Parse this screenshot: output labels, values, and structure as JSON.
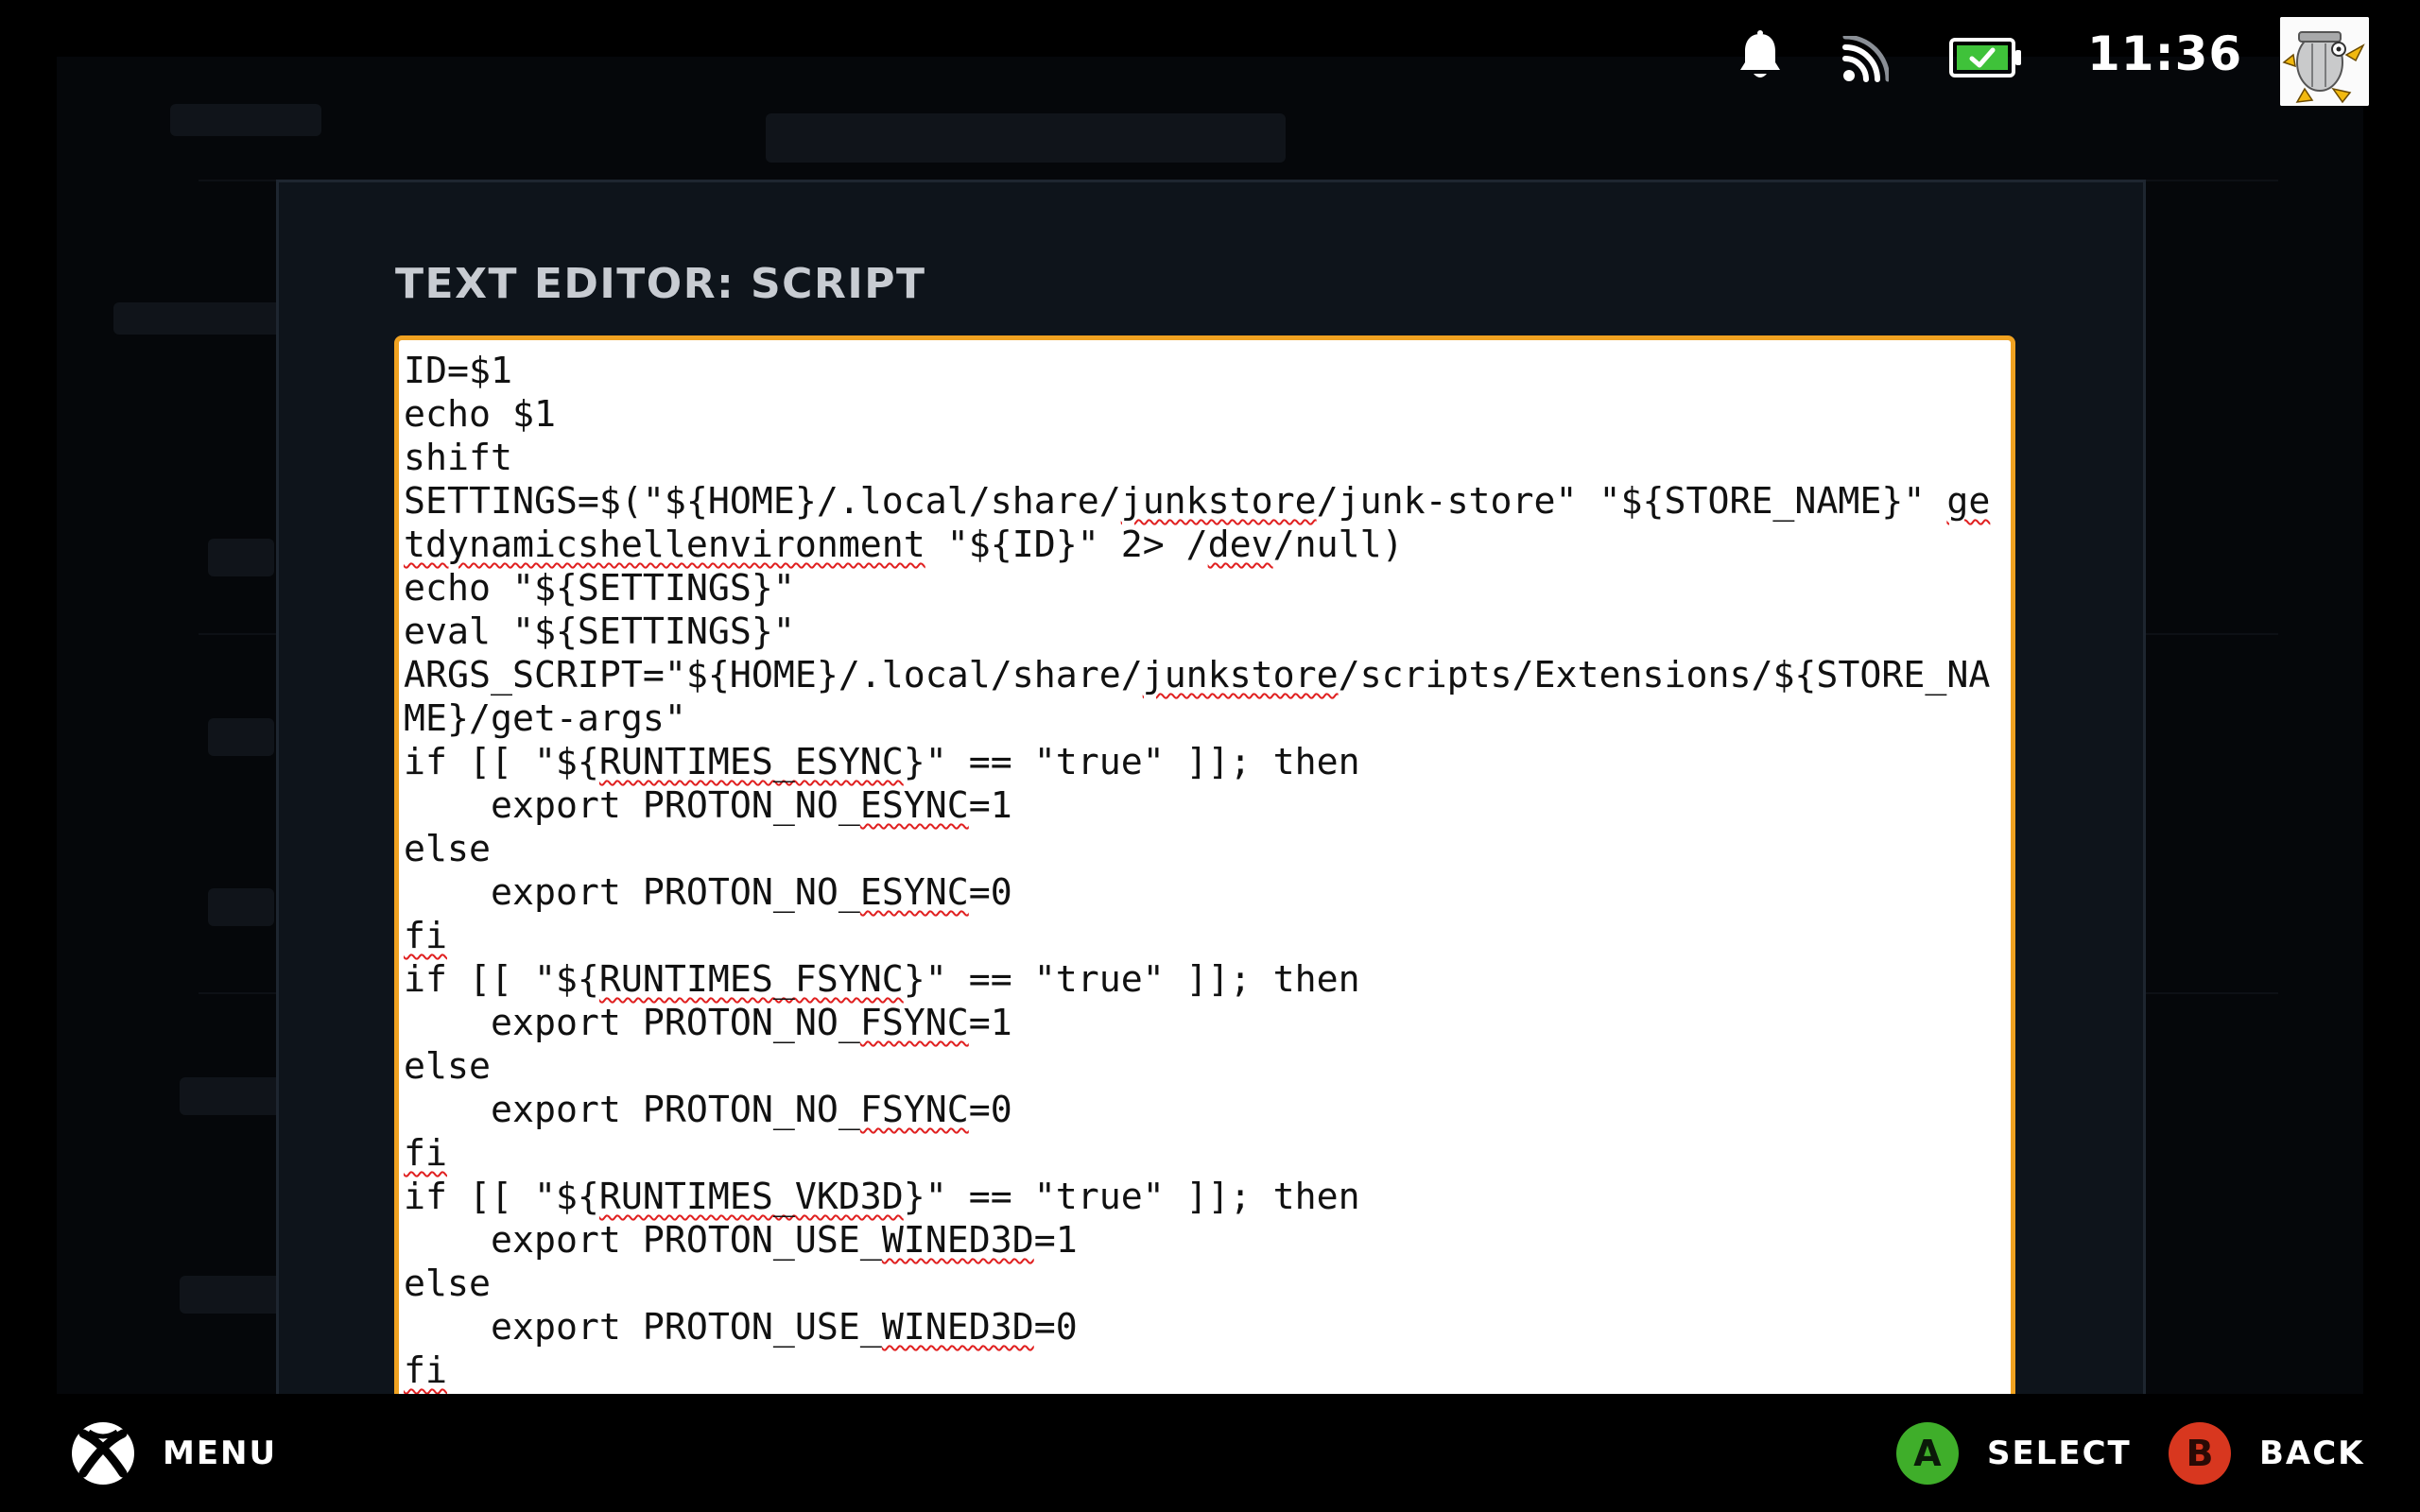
{
  "status_bar": {
    "time": "11:36",
    "icons": [
      "notification-bell-icon",
      "wifi-icon",
      "battery-charging-icon"
    ],
    "avatar": "user-avatar"
  },
  "modal": {
    "title": "TEXT EDITOR: SCRIPT",
    "accent_color": "#f0a221",
    "lines": [
      [
        {
          "t": "ID=$1"
        }
      ],
      [
        {
          "t": "echo $1"
        }
      ],
      [
        {
          "t": "shift"
        }
      ],
      [
        {
          "t": "SETTINGS=$(\"${HOME}/.local/share/"
        },
        {
          "t": "junkstore",
          "sq": true
        },
        {
          "t": "/junk-store\" \"${STORE_NAME}\" "
        },
        {
          "t": "getdynamicshellenvironment",
          "sq": true
        },
        {
          "t": " \"${ID}\" 2> /"
        },
        {
          "t": "dev",
          "sq": true
        },
        {
          "t": "/null)"
        }
      ],
      [
        {
          "t": "echo \"${SETTINGS}\""
        }
      ],
      [
        {
          "t": "eval \"${SETTINGS}\""
        }
      ],
      [
        {
          "t": "ARGS_SCRIPT=\"${HOME}/.local/share/"
        },
        {
          "t": "junkstore",
          "sq": true
        },
        {
          "t": "/scripts/Extensions/${STORE_NAME}/get-args\""
        }
      ],
      [
        {
          "t": "if [[ \"${"
        },
        {
          "t": "RUNTIMES_ESYNC",
          "sq": true
        },
        {
          "t": "}\" == \"true\" ]]; then"
        }
      ],
      [
        {
          "t": "    export PROTON_NO_"
        },
        {
          "t": "ESYNC",
          "sq": true
        },
        {
          "t": "=1"
        }
      ],
      [
        {
          "t": "else"
        }
      ],
      [
        {
          "t": "    export PROTON_NO_"
        },
        {
          "t": "ESYNC",
          "sq": true
        },
        {
          "t": "=0"
        }
      ],
      [
        {
          "t": "fi",
          "sq": true
        }
      ],
      [
        {
          "t": "if [[ \"${"
        },
        {
          "t": "RUNTIMES_FSYNC",
          "sq": true
        },
        {
          "t": "}\" == \"true\" ]]; then"
        }
      ],
      [
        {
          "t": "    export PROTON_NO_"
        },
        {
          "t": "FSYNC",
          "sq": true
        },
        {
          "t": "=1"
        }
      ],
      [
        {
          "t": "else"
        }
      ],
      [
        {
          "t": "    export PROTON_NO_"
        },
        {
          "t": "FSYNC",
          "sq": true
        },
        {
          "t": "=0"
        }
      ],
      [
        {
          "t": "fi",
          "sq": true
        }
      ],
      [
        {
          "t": "if [[ \"${"
        },
        {
          "t": "RUNTIMES_VKD3D",
          "sq": true
        },
        {
          "t": "}\" == \"true\" ]]; then"
        }
      ],
      [
        {
          "t": "    export PROTON_USE_"
        },
        {
          "t": "WINED3D",
          "sq": true
        },
        {
          "t": "=1"
        }
      ],
      [
        {
          "t": "else"
        }
      ],
      [
        {
          "t": "    export PROTON_USE_"
        },
        {
          "t": "WINED3D",
          "sq": true
        },
        {
          "t": "=0"
        }
      ],
      [
        {
          "t": "fi",
          "sq": true
        }
      ]
    ]
  },
  "bottom_bar": {
    "menu_label": "MENU",
    "select_glyph": "A",
    "select_label": "SELECT",
    "back_glyph": "B",
    "back_label": "BACK",
    "a_color": "#3fae2a",
    "b_color": "#d8371f"
  }
}
